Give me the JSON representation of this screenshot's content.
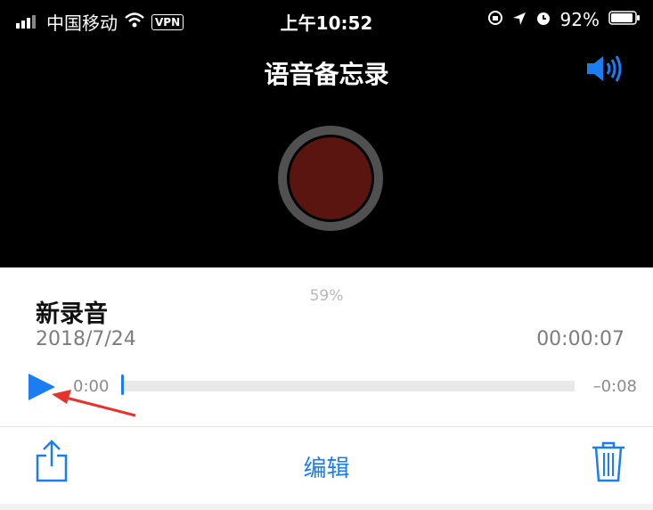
{
  "status_bar": {
    "carrier": "中国移动",
    "vpn": "VPN",
    "time": "上午10:52",
    "battery": "92%",
    "icons": [
      "signal-icon",
      "wifi-icon",
      "lock-rotation-icon",
      "location-icon",
      "alarm-icon",
      "battery-icon"
    ]
  },
  "header": {
    "title": "语音备忘录",
    "speaker_icon": "speaker-icon"
  },
  "accent_color": "#1a7ef0",
  "record_button_color": "#5a1510",
  "recording": {
    "progress_text": "59%",
    "title": "新录音",
    "date": "2018/7/24",
    "duration": "00:00:07",
    "elapsed": "0:00",
    "remaining": "–0:08",
    "playhead_fraction": 0.0
  },
  "toolbar": {
    "edit_label": "编辑",
    "share_icon": "share-icon",
    "trash_icon": "trash-icon"
  },
  "annotation": {
    "color": "#e8322e"
  }
}
